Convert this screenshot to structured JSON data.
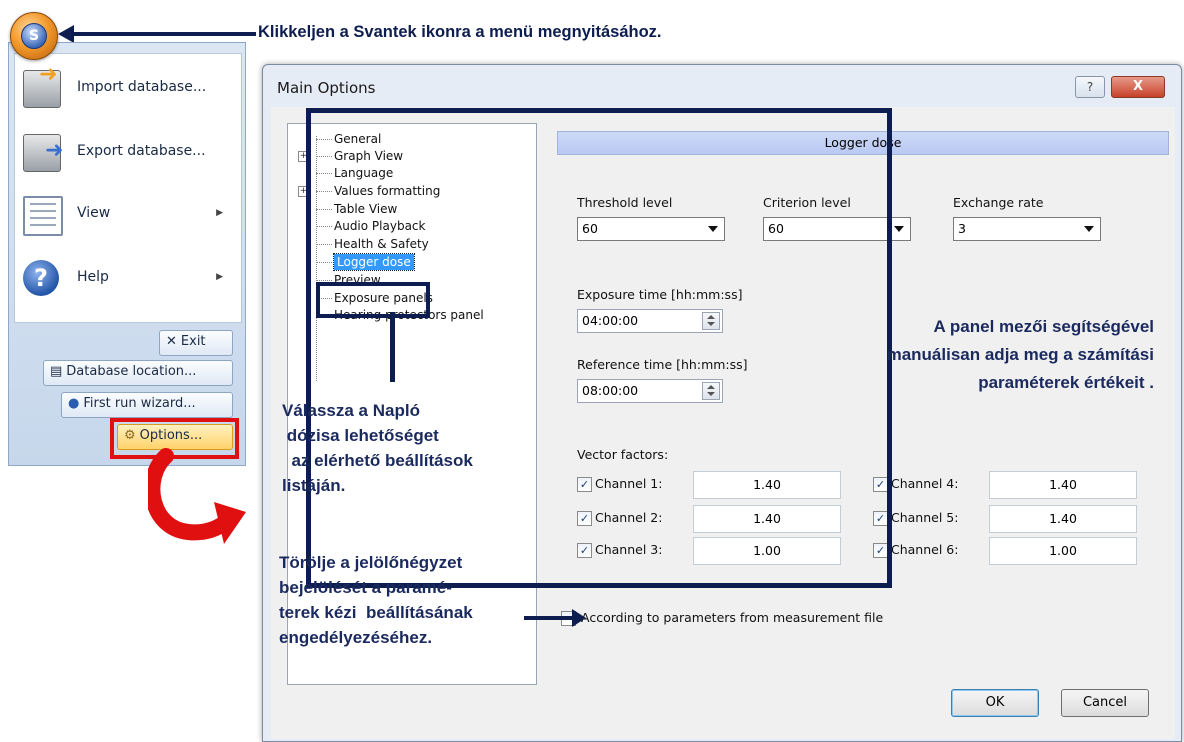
{
  "callouts": {
    "top": "Klikkeljen a Svantek ikonra a menü megnyitásához.",
    "select_logger": [
      "Válassza a Napló",
      " dózisa lehetőséget",
      "  az elérhető beállítások",
      "listáján."
    ],
    "uncheck": [
      "Törölje a jelölőnégyzet",
      "bejelölését a paramé-",
      "terek kézi  beállításának",
      "engedélyezéséhez."
    ],
    "panel_fields": [
      "A panel mezői segítségével",
      "manuálisan adja meg a számítási",
      "paraméterek értékeit ."
    ]
  },
  "app_menu": {
    "orb_glyph": "S",
    "items": [
      {
        "label": "Import database...",
        "icon": "import-database-icon"
      },
      {
        "label": "Export database...",
        "icon": "export-database-icon"
      },
      {
        "label": "View",
        "icon": "view-icon",
        "submenu": true
      },
      {
        "label": "Help",
        "icon": "help-icon",
        "submenu": true
      }
    ],
    "buttons": {
      "exit": "Exit",
      "database_location": "Database location...",
      "first_run": "First run wizard...",
      "options": "Options..."
    }
  },
  "dialog": {
    "title": "Main Options",
    "help_glyph": "?",
    "close_glyph": "X",
    "tree": [
      {
        "label": "General",
        "expandable": false
      },
      {
        "label": "Graph View",
        "expandable": true
      },
      {
        "label": "Language",
        "expandable": false
      },
      {
        "label": "Values formatting",
        "expandable": true
      },
      {
        "label": "Table View",
        "expandable": false
      },
      {
        "label": "Audio Playback",
        "expandable": false
      },
      {
        "label": "Health & Safety",
        "expandable": false
      },
      {
        "label": "Logger dose",
        "expandable": false,
        "selected": true
      },
      {
        "label": "Preview",
        "expandable": false
      },
      {
        "label": "Exposure panels",
        "expandable": false
      },
      {
        "label": "Hearing protectors panel",
        "expandable": false
      }
    ],
    "panel_title": "Logger dose",
    "threshold_label": "Threshold level",
    "threshold_value": "60",
    "criterion_label": "Criterion level",
    "criterion_value": "60",
    "exchange_label": "Exchange rate",
    "exchange_value": "3",
    "exposure_label": "Exposure time [hh:mm:ss]",
    "exposure_value": "04:00:00",
    "reference_label": "Reference time [hh:mm:ss]",
    "reference_value": "08:00:00",
    "vector_label": "Vector factors:",
    "channels": [
      {
        "label": "Channel 1:",
        "value": "1.40",
        "checked": true
      },
      {
        "label": "Channel 2:",
        "value": "1.40",
        "checked": true
      },
      {
        "label": "Channel 3:",
        "value": "1.00",
        "checked": true
      },
      {
        "label": "Channel 4:",
        "value": "1.40",
        "checked": true
      },
      {
        "label": "Channel 5:",
        "value": "1.40",
        "checked": true
      },
      {
        "label": "Channel 6:",
        "value": "1.00",
        "checked": true
      }
    ],
    "measurement_checkbox": {
      "label": "According to parameters from measurement file",
      "checked": false
    },
    "ok": "OK",
    "cancel": "Cancel"
  },
  "colors": {
    "annotation": "#0d1d4f",
    "highlight": "#e01010",
    "tree_selection": "#3399ff"
  }
}
